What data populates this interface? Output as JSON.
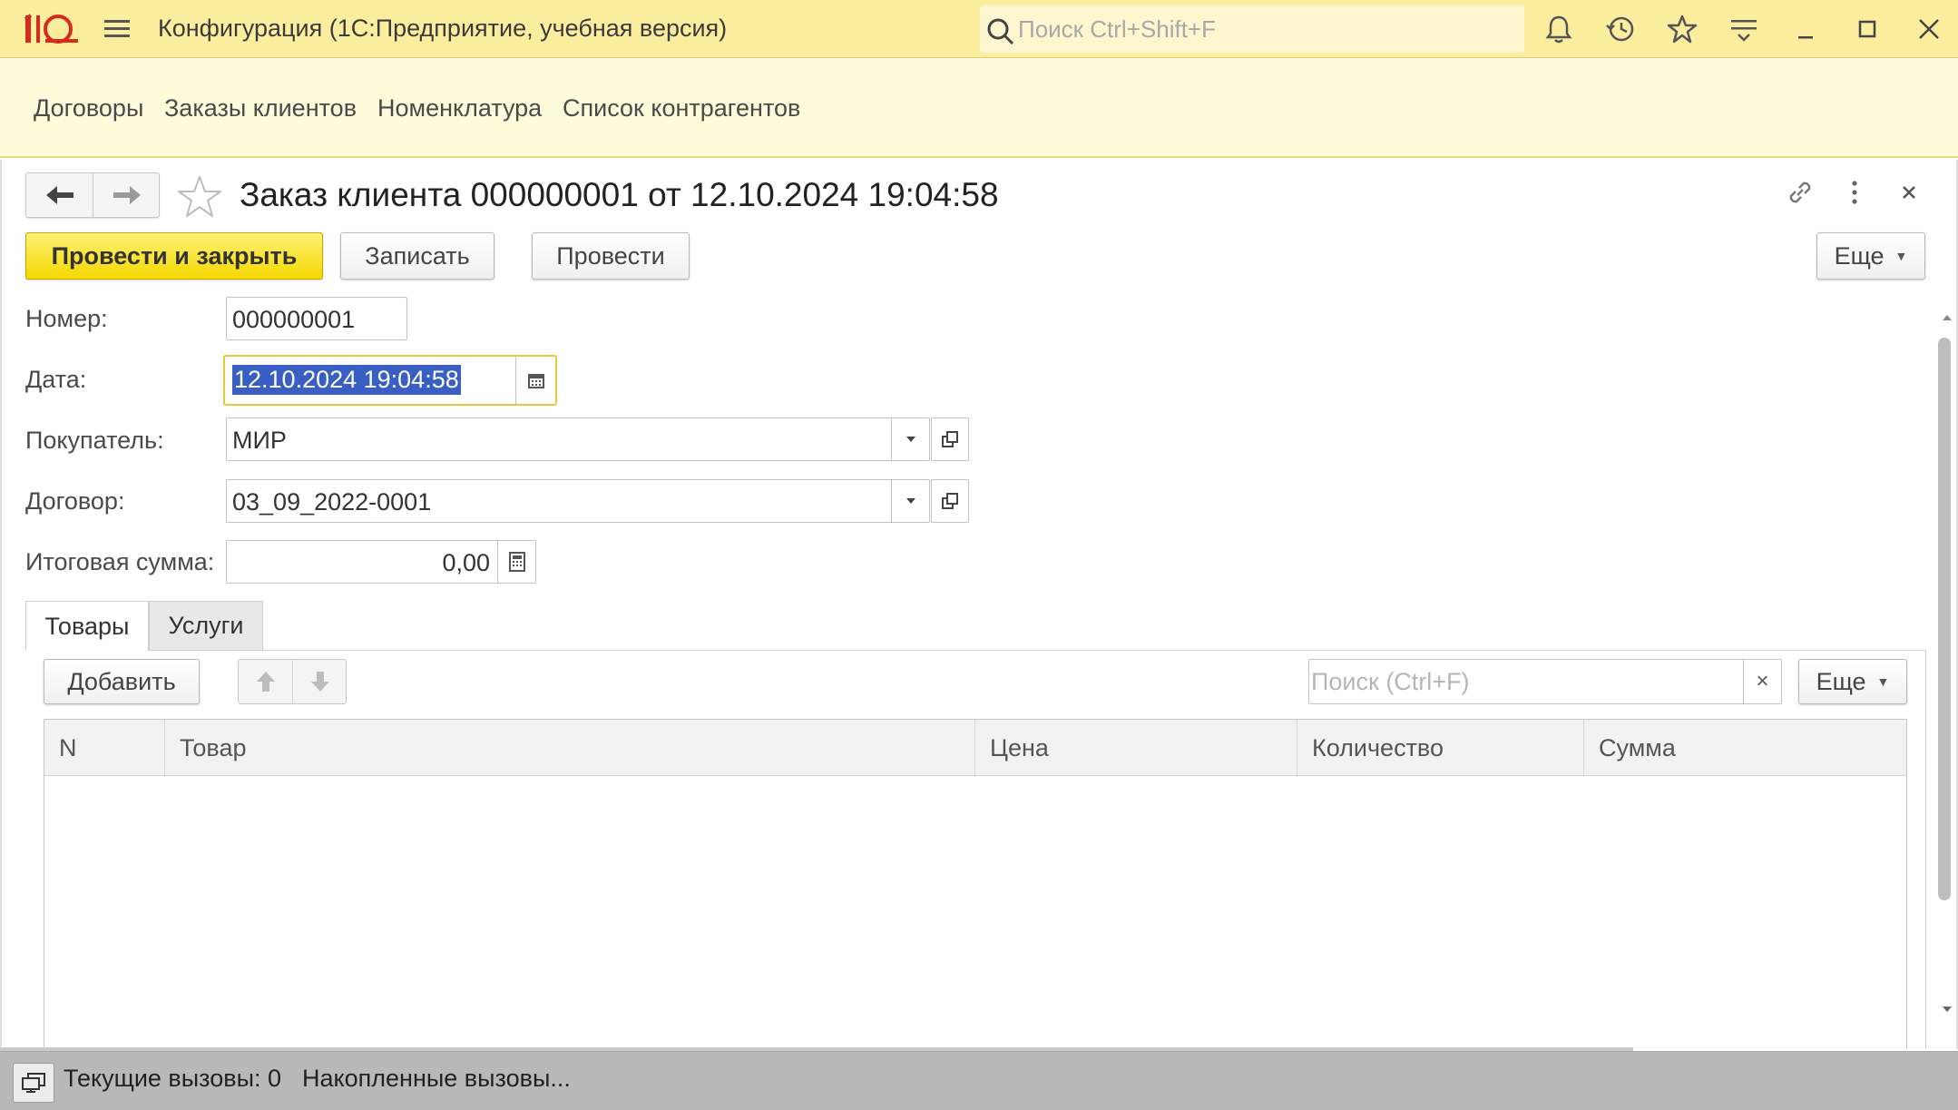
{
  "titlebar": {
    "app_title": "Конфигурация  (1С:Предприятие, учебная версия)",
    "search_placeholder": "Поиск Ctrl+Shift+F",
    "accent": "#fbed9e"
  },
  "sections": {
    "items": [
      {
        "label": "Договоры"
      },
      {
        "label": "Заказы клиентов"
      },
      {
        "label": "Номенклатура"
      },
      {
        "label": "Список контрагентов"
      }
    ]
  },
  "form": {
    "title": "Заказ клиента 000000001 от 12.10.2024 19:04:58",
    "actions": {
      "post_close": "Провести и закрыть",
      "save": "Записать",
      "post": "Провести",
      "more": "Еще"
    },
    "fields": {
      "number": {
        "label": "Номер:",
        "value": "000000001"
      },
      "date": {
        "label": "Дата:",
        "value": "12.10.2024 19:04:58"
      },
      "buyer": {
        "label": "Покупатель:",
        "value": "МИР"
      },
      "contract": {
        "label": "Договор:",
        "value": "03_09_2022-0001"
      },
      "total": {
        "label": "Итоговая сумма:",
        "value": "0,00"
      }
    },
    "tabs": [
      {
        "label": "Товары",
        "active": true
      },
      {
        "label": "Услуги",
        "active": false
      }
    ],
    "table_toolbar": {
      "add": "Добавить",
      "search_placeholder": "Поиск (Ctrl+F)",
      "more": "Еще"
    },
    "table": {
      "columns": [
        "N",
        "Товар",
        "Цена",
        "Количество",
        "Сумма"
      ],
      "rows": []
    }
  },
  "statusbar": {
    "current_calls": "Текущие вызовы: 0",
    "accumulated_calls": "Накопленные вызовы..."
  }
}
